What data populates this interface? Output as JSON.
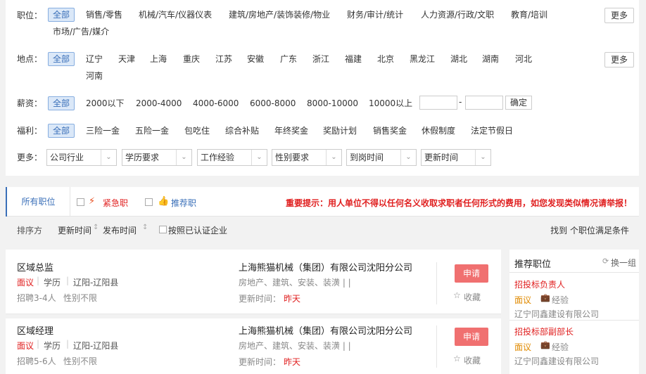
{
  "filters": {
    "position": {
      "label": "职位：",
      "all": "全部",
      "items": [
        "销售/零售",
        "机械/汽车/仪器仪表",
        "建筑/房地产/装饰装修/物业",
        "财务/审计/统计",
        "人力资源/行政/文职",
        "教育/培训",
        "市场/广告/媒介"
      ],
      "more": "更多"
    },
    "location": {
      "label": "地点：",
      "all": "全部",
      "items": [
        "辽宁",
        "天津",
        "上海",
        "重庆",
        "江苏",
        "安徽",
        "广东",
        "浙江",
        "福建",
        "北京",
        "黑龙江",
        "湖北",
        "湖南",
        "河北",
        "河南"
      ],
      "more": "更多"
    },
    "salary": {
      "label": "薪资：",
      "all": "全部",
      "items": [
        "2000以下",
        "2000-4000",
        "4000-6000",
        "6000-8000",
        "8000-10000",
        "10000以上"
      ],
      "min_value": "",
      "max_value": "",
      "dash": "-",
      "confirm": "确定"
    },
    "welfare": {
      "label": "福利：",
      "all": "全部",
      "items": [
        "三险一金",
        "五险一金",
        "包吃住",
        "综合补贴",
        "年终奖金",
        "奖励计划",
        "销售奖金",
        "休假制度",
        "法定节假日"
      ]
    },
    "more": {
      "label": "更多：",
      "selects": [
        "公司行业",
        "学历要求",
        "工作经验",
        "性别要求",
        "到岗时间",
        "更新时间"
      ]
    }
  },
  "tabs": {
    "all_jobs": "所有职位",
    "urgent": "紧急职",
    "recommended": "推荐职",
    "notice": "重要提示：用人单位不得以任何名义收取求职者任何形式的费用，如您发现类似情况请举报！"
  },
  "sort": {
    "label": "排序方",
    "update_time": "更新时间",
    "publish_time": "发布时间",
    "certified": "按照已认证企业",
    "result_text": "找到 个职位满足条件"
  },
  "jobs": [
    {
      "title": "区域总监",
      "salary": "面议",
      "education": "学历",
      "location": "辽阳-辽阳县",
      "headcount": "招聘3-4人",
      "gender": "性别不限",
      "company": "上海熊猫机械（集团）有限公司沈阳分公司",
      "industry": "房地产、建筑、安装、装潢 | |",
      "update_label": "更新时间：",
      "update_value": "昨天",
      "apply": "申请",
      "favorite": "收藏"
    },
    {
      "title": "区域经理",
      "salary": "面议",
      "education": "学历",
      "location": "辽阳-辽阳县",
      "headcount": "招聘5-6人",
      "gender": "性别不限",
      "company": "上海熊猫机械（集团）有限公司沈阳分公司",
      "industry": "房地产、建筑、安装、装潢 | |",
      "update_label": "更新时间：",
      "update_value": "昨天",
      "apply": "申请",
      "favorite": "收藏"
    }
  ],
  "sidebar": {
    "title": "推荐职位",
    "refresh": "换一组",
    "items": [
      {
        "title": "招投标负责人",
        "salary": "面议",
        "experience": "经验",
        "company": "辽宁同鑫建设有限公司"
      },
      {
        "title": "招投标部副部长",
        "salary": "面议",
        "experience": "经验",
        "company": "辽宁同鑫建设有限公司"
      }
    ]
  },
  "colors": {
    "accent_blue": "#3a6fb8",
    "red": "#e02020",
    "apply_bg": "#f07070",
    "orange": "#e08a00"
  }
}
